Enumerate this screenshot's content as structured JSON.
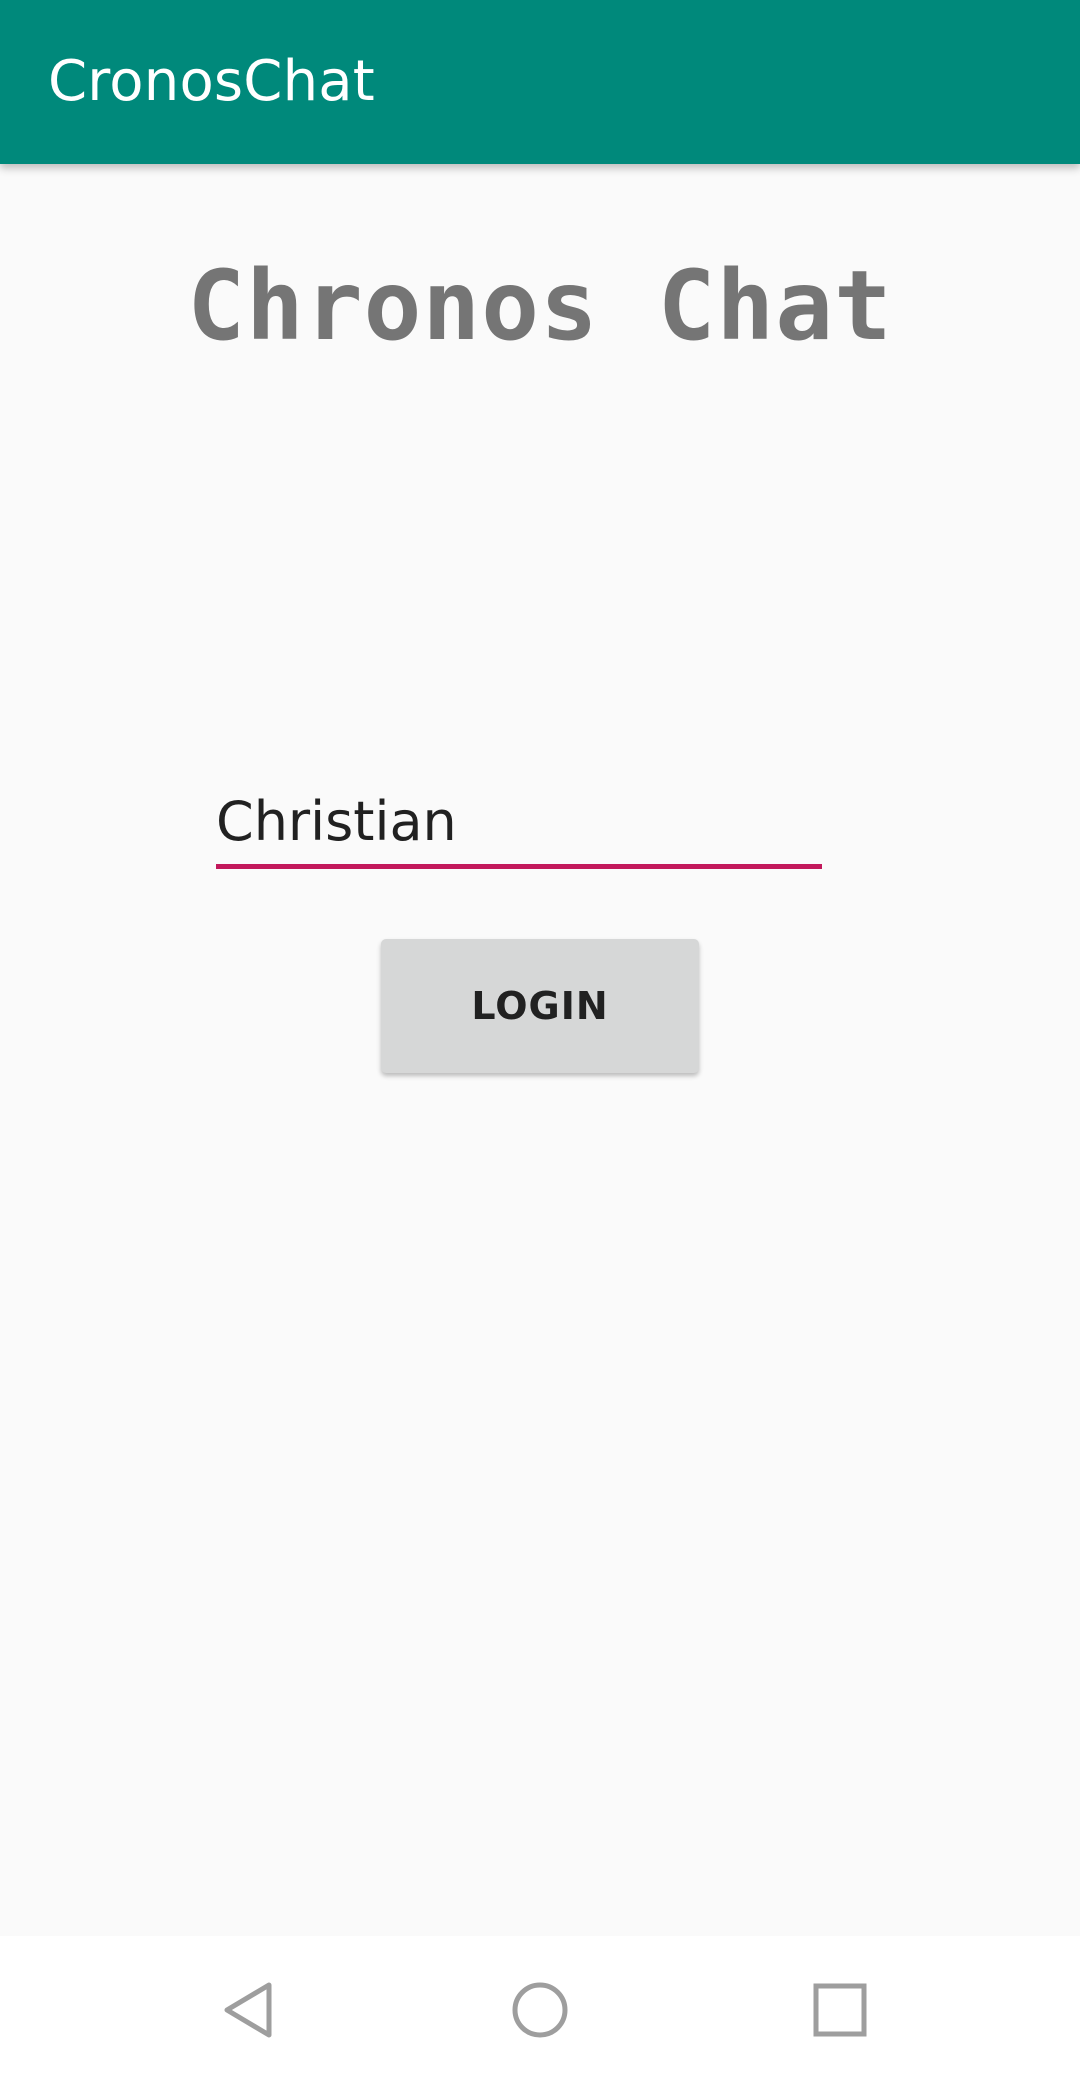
{
  "app_bar": {
    "title": "CronosChat",
    "background": "#00897b"
  },
  "main": {
    "hero_title": "Chronos Chat",
    "username_input": {
      "value": "Christian",
      "placeholder": ""
    },
    "login_button": {
      "label": "LOGIN"
    },
    "accent_color": "#c2185b"
  },
  "nav_bar": {
    "buttons": [
      {
        "icon": "back-triangle-icon"
      },
      {
        "icon": "home-circle-icon"
      },
      {
        "icon": "recents-square-icon"
      }
    ]
  }
}
